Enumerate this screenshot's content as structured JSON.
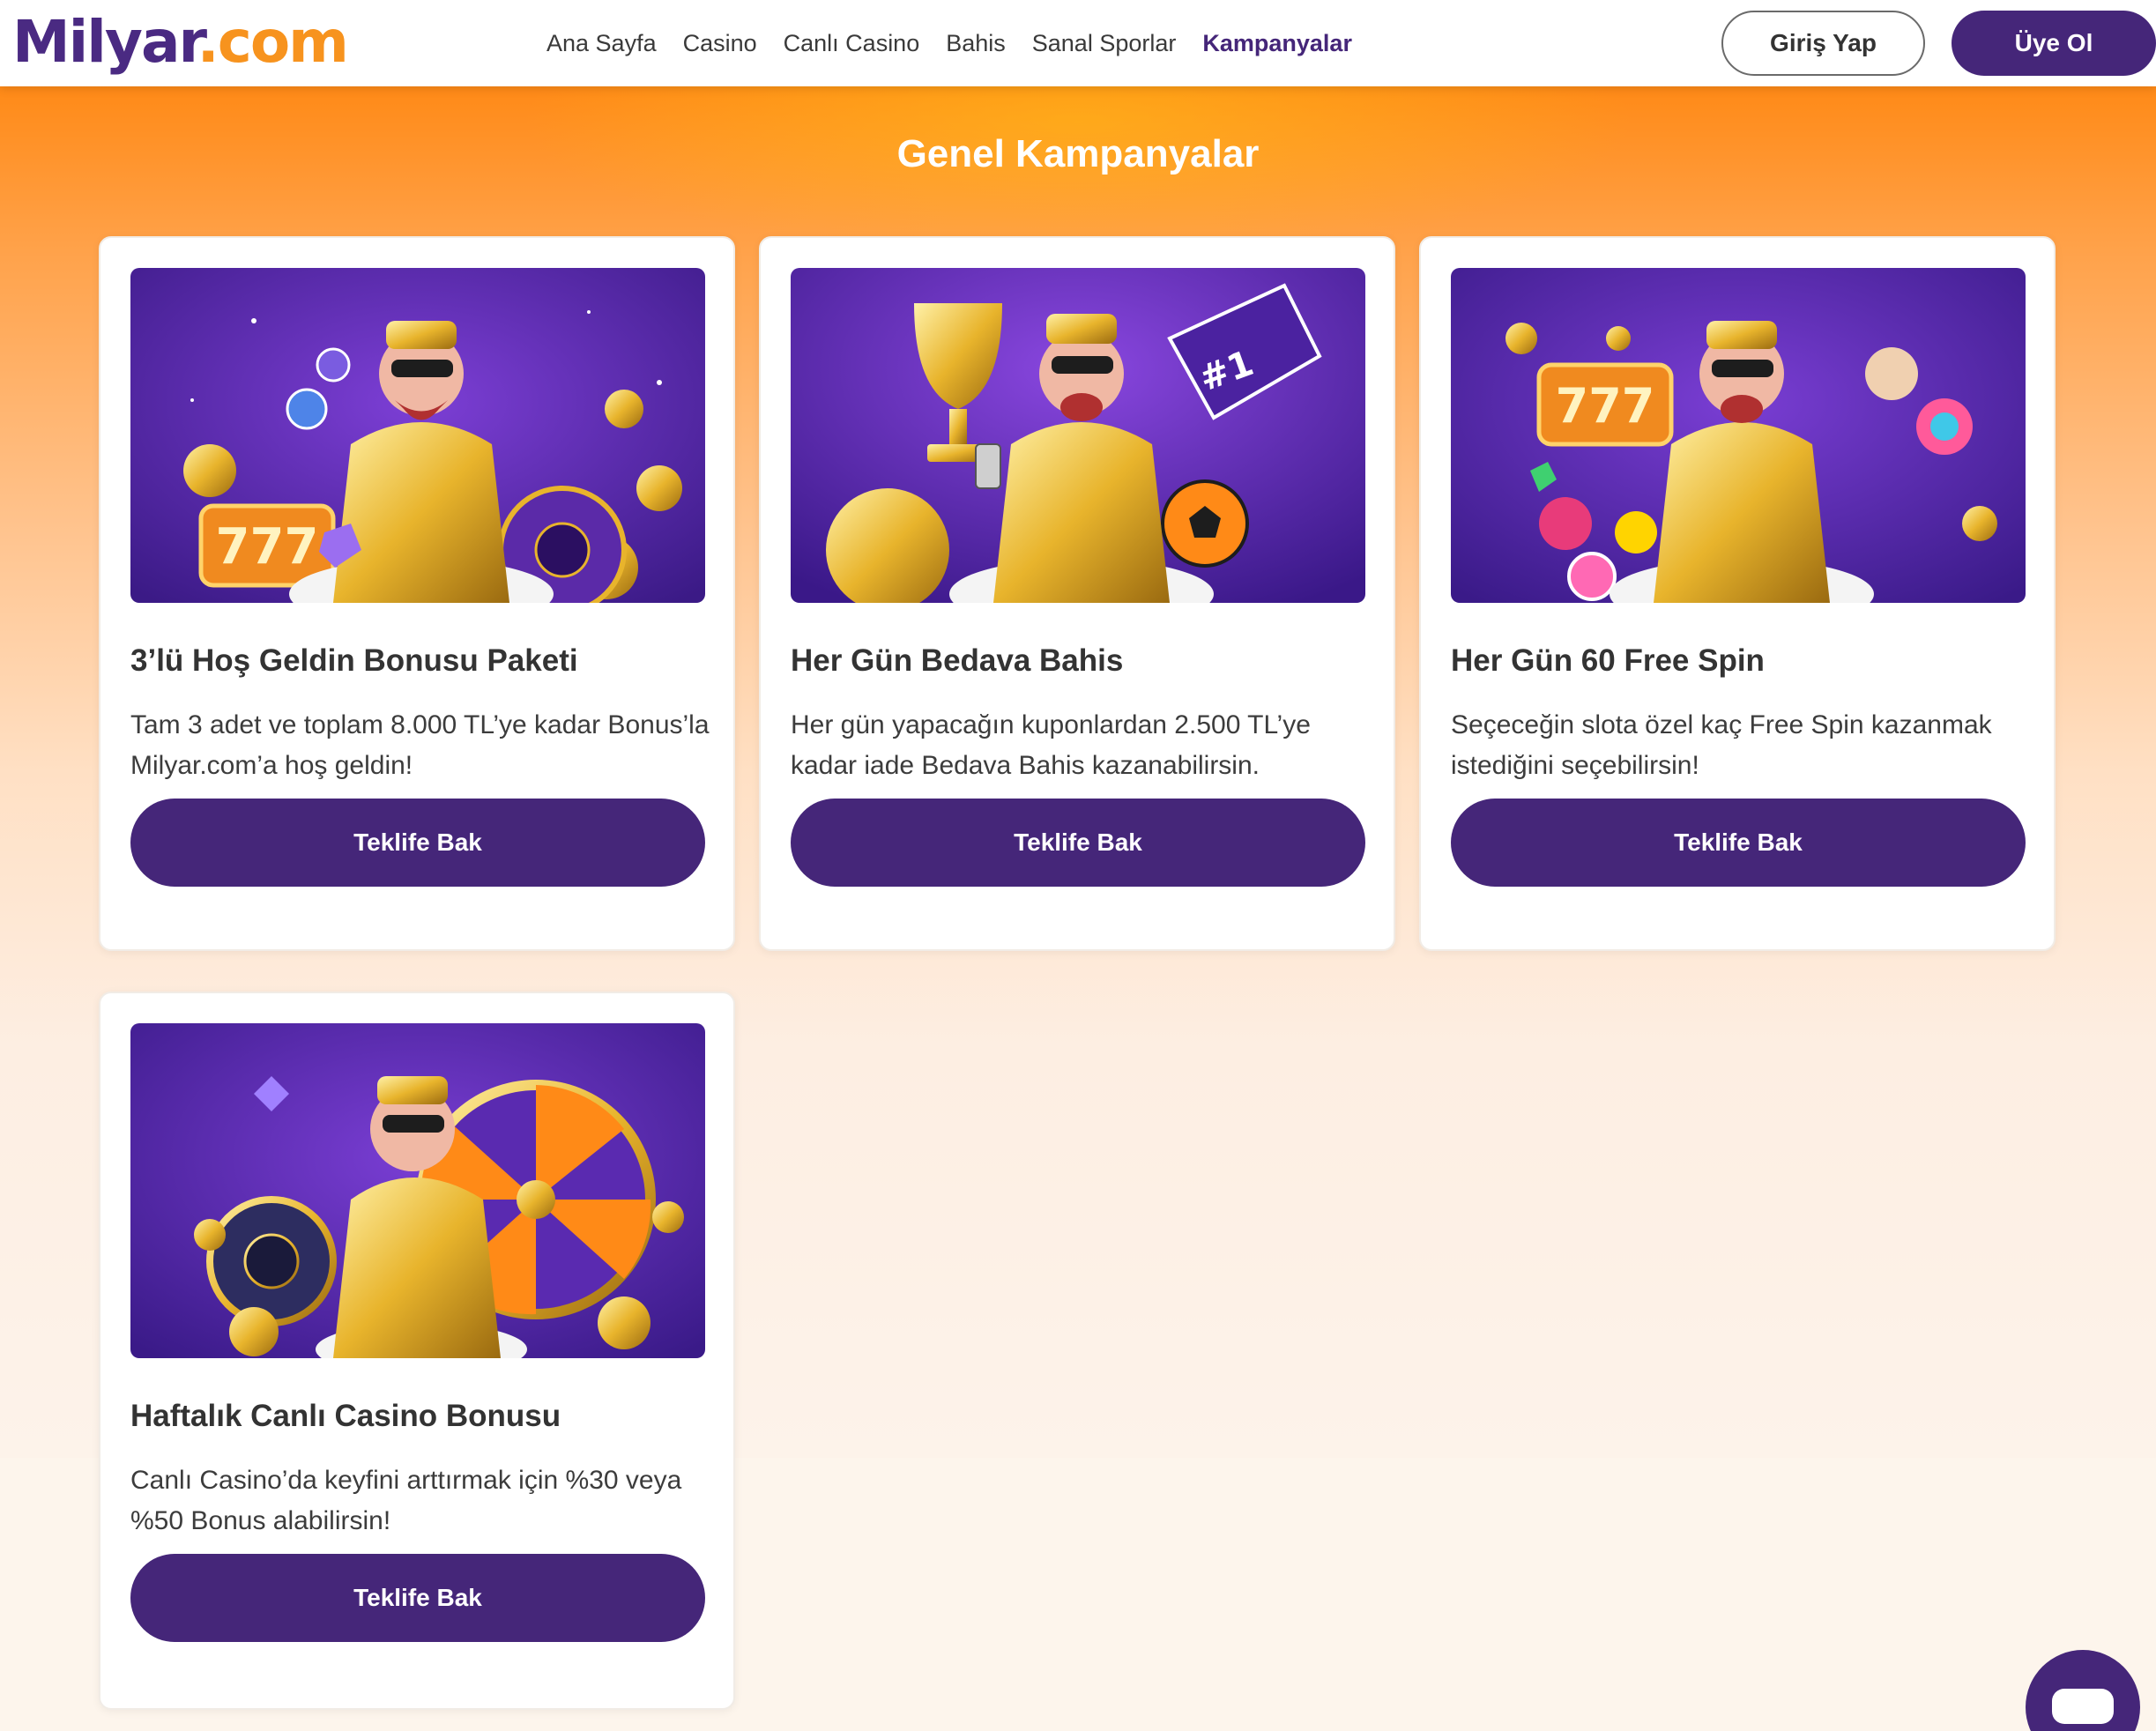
{
  "header": {
    "logo": {
      "part1": "Milyar",
      "part2": ".com"
    },
    "nav": [
      {
        "label": "Ana Sayfa",
        "active": false
      },
      {
        "label": "Casino",
        "active": false
      },
      {
        "label": "Canlı Casino",
        "active": false
      },
      {
        "label": "Bahis",
        "active": false
      },
      {
        "label": "Sanal Sporlar",
        "active": false
      },
      {
        "label": "Kampanyalar",
        "active": true
      }
    ],
    "login_label": "Giriş Yap",
    "register_label": "Üye Ol"
  },
  "section": {
    "title": "Genel Kampanyalar"
  },
  "cards": [
    {
      "title": "3’lü Hoş Geldin Bonusu Paketi",
      "description": "Tam 3 adet ve toplam 8.000 TL’ye kadar Bonus’la Milyar.com’a hoş geldin!",
      "button": "Teklife Bak"
    },
    {
      "title": "Her Gün Bedava Bahis",
      "description": "Her gün yapacağın kuponlardan 2.500 TL’ye kadar iade Bedava Bahis kazanabilirsin.",
      "button": "Teklife Bak"
    },
    {
      "title": "Her Gün 60 Free Spin",
      "description": "Seçeceğin slota özel kaç Free Spin kazanmak istediğini seçebilirsin!",
      "button": "Teklife Bak"
    },
    {
      "title": "Haftalık Canlı Casino Bonusu",
      "description": "Canlı Casino’da keyfini arttırmak için %30 veya %50 Bonus alabilirsin!",
      "button": "Teklife Bak"
    }
  ],
  "colors": {
    "brand_purple": "#452679",
    "brand_orange": "#f7931e",
    "hero_orange": "#ff8a17"
  },
  "icons": {
    "chat": "chat-icon"
  }
}
